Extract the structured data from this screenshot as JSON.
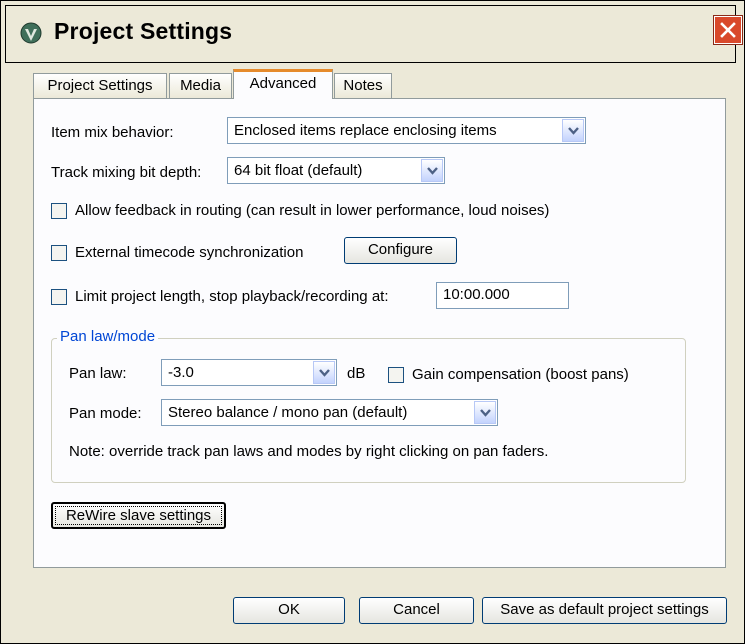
{
  "window": {
    "title": "Project Settings"
  },
  "tabs": [
    {
      "label": "Project Settings"
    },
    {
      "label": "Media"
    },
    {
      "label": "Advanced"
    },
    {
      "label": "Notes"
    }
  ],
  "advanced": {
    "item_mix_label": "Item mix behavior:",
    "item_mix_value": "Enclosed items replace enclosing items",
    "bit_depth_label": "Track mixing bit depth:",
    "bit_depth_value": "64 bit float (default)",
    "allow_feedback_label": "Allow feedback in routing (can result in lower performance, loud noises)",
    "allow_feedback_checked": false,
    "timecode_label": "External timecode synchronization",
    "timecode_checked": false,
    "configure_button": "Configure",
    "limit_length_label": "Limit project length, stop playback/recording at:",
    "limit_length_checked": false,
    "limit_length_value": "10:00.000"
  },
  "pan": {
    "group_title": "Pan law/mode",
    "pan_law_label": "Pan law:",
    "pan_law_value": "-3.0",
    "db_unit": "dB",
    "gain_comp_label": "Gain compensation (boost pans)",
    "gain_comp_checked": false,
    "pan_mode_label": "Pan mode:",
    "pan_mode_value": "Stereo balance / mono pan (default)",
    "note": "Note: override track pan laws and modes by right clicking on pan faders."
  },
  "rewire_button": "ReWire slave settings",
  "footer": {
    "ok_button": "OK",
    "cancel_button": "Cancel",
    "save_default_button": "Save as default project settings"
  },
  "colors": {
    "active_tab_accent": "#e68b2c",
    "group_title": "#0046d5",
    "close_button": "#d9492b"
  }
}
